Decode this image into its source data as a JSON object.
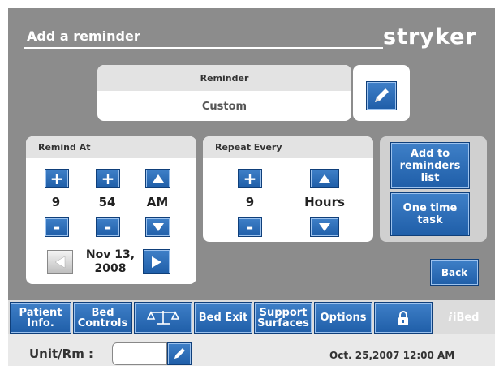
{
  "header": {
    "title": "Add a reminder",
    "logo": "stryker"
  },
  "reminder": {
    "label": "Reminder",
    "value": "Custom",
    "edit_icon": "pencil-icon"
  },
  "remind_at": {
    "label": "Remind At",
    "hour": "9",
    "minute": "54",
    "ampm": "AM",
    "date": "Nov 13,\n2008",
    "plus": "+",
    "minus": "-"
  },
  "repeat_every": {
    "label": "Repeat Every",
    "value": "9",
    "unit": "Hours",
    "plus": "+",
    "minus": "-"
  },
  "actions": {
    "add": "Add to reminders list",
    "one_time": "One time task",
    "back": "Back"
  },
  "tabs": {
    "patient_info": "Patient Info.",
    "bed_controls": "Bed Controls",
    "scale_icon": "scale-icon",
    "bed_exit": "Bed Exit",
    "support_surfaces": "Support Surfaces",
    "options": "Options",
    "lock_icon": "lock-icon",
    "ibed": "iBed"
  },
  "status": {
    "unit_label": "Unit/Rm :",
    "unit_value": "",
    "datetime": "Oct. 25,2007 12:00 AM"
  },
  "colors": {
    "accent_blue": "#2a6bb8",
    "background_gray": "#8c8c8c",
    "panel": "#ffffff"
  }
}
